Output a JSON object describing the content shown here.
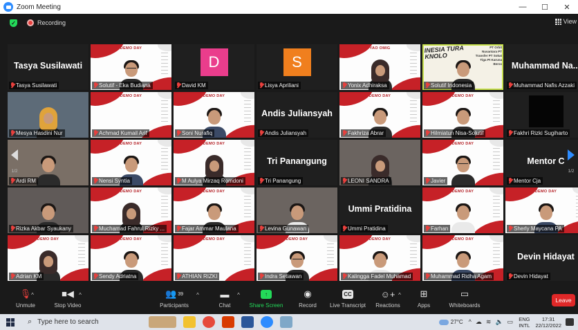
{
  "window": {
    "title": "Zoom Meeting",
    "minimize": "—",
    "maximize": "☐",
    "close": "✕"
  },
  "infobar": {
    "recording_label": "Recording",
    "view_label": "View"
  },
  "tiles": [
    {
      "type": "name",
      "big": "Tasya Susilawati",
      "label": "Tasya Susilawati"
    },
    {
      "type": "slide_person",
      "label": "Solutif - Eka Budiana"
    },
    {
      "type": "avatar",
      "letter": "D",
      "color": "#ea3d8c",
      "label": "David KM"
    },
    {
      "type": "avatar",
      "letter": "S",
      "color": "#f07f1e",
      "label": "Lisya Apriliani"
    },
    {
      "type": "slide_person",
      "label": "Yonix Adhiraksa"
    },
    {
      "type": "photo",
      "label": "Solutif Indonesia"
    },
    {
      "type": "name",
      "big": "Muhammad Na...",
      "label": "Muhammad Nafis Azzaki"
    },
    {
      "type": "photo",
      "label": "Mesya Hasdini Nur"
    },
    {
      "type": "slide",
      "label": "Achmad Kumail Arif"
    },
    {
      "type": "slide_person",
      "label": "Soni Nurafiq"
    },
    {
      "type": "name",
      "big": "Andis Juliansyah",
      "label": "Andis Juliansyah"
    },
    {
      "type": "slide_person",
      "label": "Fakhriza Abrar"
    },
    {
      "type": "slide_person",
      "label": "Hilmiatun Nisa-Solutif"
    },
    {
      "type": "dark",
      "label": "Fakhri Rizki Sugiharto"
    },
    {
      "type": "photo",
      "label": "Ardi RM"
    },
    {
      "type": "slide_person",
      "label": "Nensi Syntia"
    },
    {
      "type": "slide_person",
      "label": "M Aulya Mirzaq Romdoni"
    },
    {
      "type": "name",
      "big": "Tri Panangung",
      "label": "Tri Panangung"
    },
    {
      "type": "photo",
      "label": "LEONI SANDRA"
    },
    {
      "type": "slide_person",
      "label": "Javier"
    },
    {
      "type": "name",
      "big": "Mentor C",
      "label": "Mentor Cja"
    },
    {
      "type": "photo",
      "label": "Rizka Akbar Syaukany"
    },
    {
      "type": "slide_person",
      "label": "Muchamad Fahrul Rizky ..."
    },
    {
      "type": "slide_person",
      "label": "Fajar Ammar Maulana"
    },
    {
      "type": "photo",
      "label": "Levina Gunawan"
    },
    {
      "type": "name",
      "big": "Ummi Pratidina",
      "label": "Ummi Pratidina"
    },
    {
      "type": "slide_person",
      "label": "Farhan"
    },
    {
      "type": "slide_person",
      "label": "Sherly Maycana PA"
    },
    {
      "type": "slide_person",
      "label": "Adrian KM"
    },
    {
      "type": "slide_person",
      "label": "Sendy Adriatna"
    },
    {
      "type": "slide",
      "label": "ATHIAN RIZKI"
    },
    {
      "type": "slide_person",
      "label": "Indra Setiawan"
    },
    {
      "type": "slide_person",
      "label": "Kalingga Fadel Muhamad"
    },
    {
      "type": "slide_person",
      "label": "Muhammad Ridha Agam"
    },
    {
      "type": "name",
      "big": "Devin Hidayat",
      "label": "Devin Hidayat"
    }
  ],
  "slide_text": {
    "demo_day": "DEMO DAY",
    "yao": "YAO OMIG",
    "banner": "INESIA TURA KNOLO",
    "pt_list": "PT Orbit Nusantara PT Transfer PT Sokat Tiga Pt Karuna Berss"
  },
  "pager": {
    "left": "1/2",
    "right": "1/2"
  },
  "toolbar": {
    "unmute": "Unmute",
    "stop_video": "Stop Video",
    "participants": "Participants",
    "participants_count": "39",
    "chat": "Chat",
    "share_screen": "Share Screen",
    "record": "Record",
    "live_transcript": "Live Transcript",
    "reactions": "Reactions",
    "apps": "Apps",
    "whiteboards": "Whiteboards",
    "leave": "Leave"
  },
  "taskbar": {
    "search_placeholder": "Type here to search",
    "temperature": "27°C",
    "lang_top": "ENG",
    "lang_bottom": "INTL",
    "time": "17:31",
    "date": "22/12/2022"
  },
  "colors": {
    "accent_blue": "#2d8cff",
    "share_green": "#23d959",
    "leave_red": "#e02828",
    "slide_red": "#c62127",
    "speaker_highlight": "#c8e14c"
  }
}
